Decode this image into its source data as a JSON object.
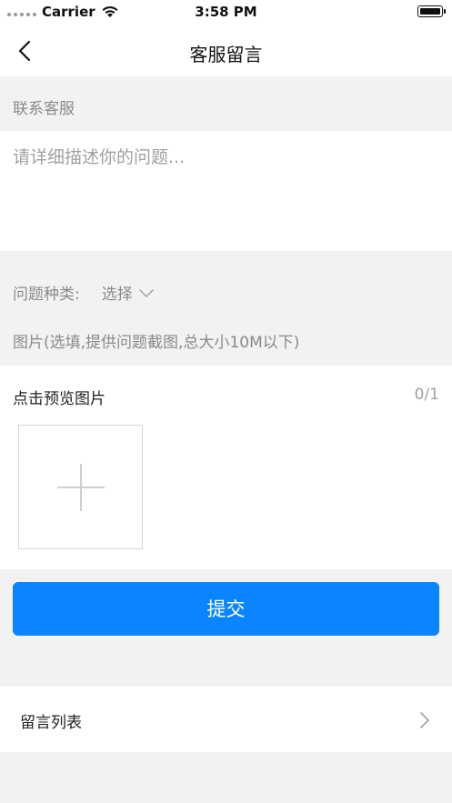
{
  "status_bar": {
    "carrier": "Carrier",
    "time": "3:58 PM"
  },
  "nav": {
    "title": "客服留言"
  },
  "contact": {
    "label": "联系客服"
  },
  "description": {
    "placeholder": "请详细描述你的问题..."
  },
  "category": {
    "label": "问题种类:",
    "select_value": "选择"
  },
  "images": {
    "hint": "图片(选填,提供问题截图,总大小10M以下)",
    "title": "点击预览图片",
    "count": "0/1"
  },
  "submit": {
    "label": "提交"
  },
  "message_list": {
    "label": "留言列表"
  },
  "colors": {
    "accent": "#0a84ff",
    "background": "#f2f2f2"
  }
}
